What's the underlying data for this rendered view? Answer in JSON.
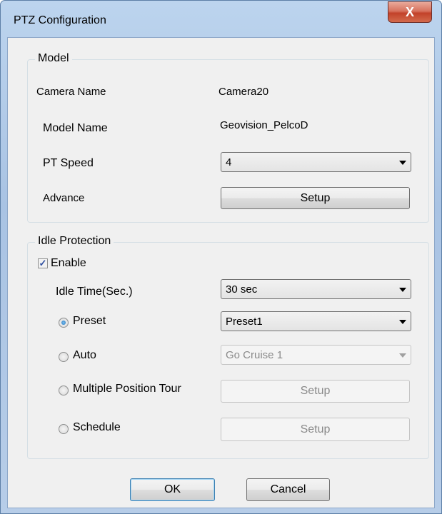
{
  "window": {
    "title": "PTZ Configuration",
    "close_label": "X"
  },
  "model": {
    "group_label": "Model",
    "camera_name_label": "Camera Name",
    "camera_name_value": "Camera20",
    "model_name_label": "Model Name",
    "model_name_value": "Geovision_PelcoD",
    "pt_speed_label": "PT Speed",
    "pt_speed_value": "4",
    "advance_label": "Advance",
    "advance_button": "Setup"
  },
  "idle": {
    "group_label": "Idle Protection",
    "enable_label": "Enable",
    "enable_checked": true,
    "idle_time_label": "Idle Time(Sec.)",
    "idle_time_value": "30 sec",
    "preset_label": "Preset",
    "preset_value": "Preset1",
    "auto_label": "Auto",
    "auto_value": "Go Cruise 1",
    "mpt_label": "Multiple Position Tour",
    "mpt_button": "Setup",
    "schedule_label": "Schedule",
    "schedule_button": "Setup",
    "selected_mode": "Preset"
  },
  "footer": {
    "ok_label": "OK",
    "cancel_label": "Cancel"
  }
}
